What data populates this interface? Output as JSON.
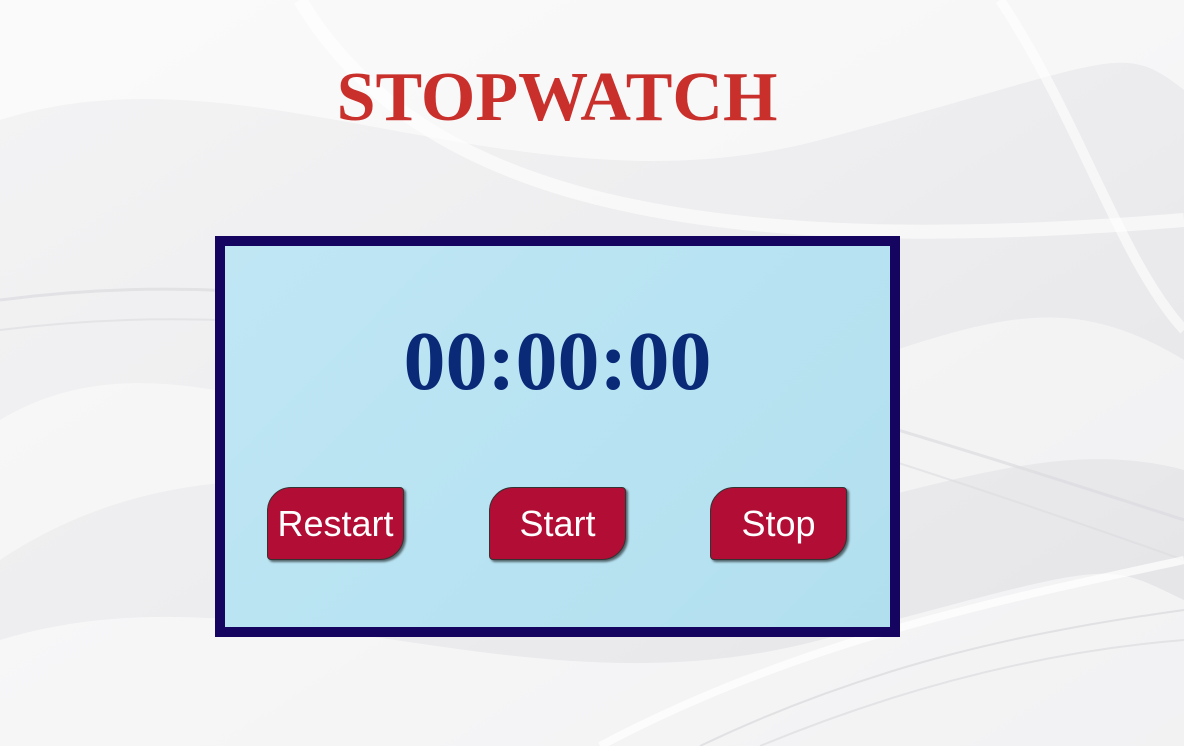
{
  "header": {
    "title": "STOPWATCH"
  },
  "stopwatch": {
    "display": "00:00:00",
    "buttons": {
      "restart_label": "Restart",
      "start_label": "Start",
      "stop_label": "Stop"
    }
  },
  "colors": {
    "title": "#c9302c",
    "panel_border": "#150560",
    "panel_background": "#bde5f3",
    "timer_text": "#0a2a78",
    "button_background": "#b20d35",
    "button_text": "#ffffff"
  }
}
